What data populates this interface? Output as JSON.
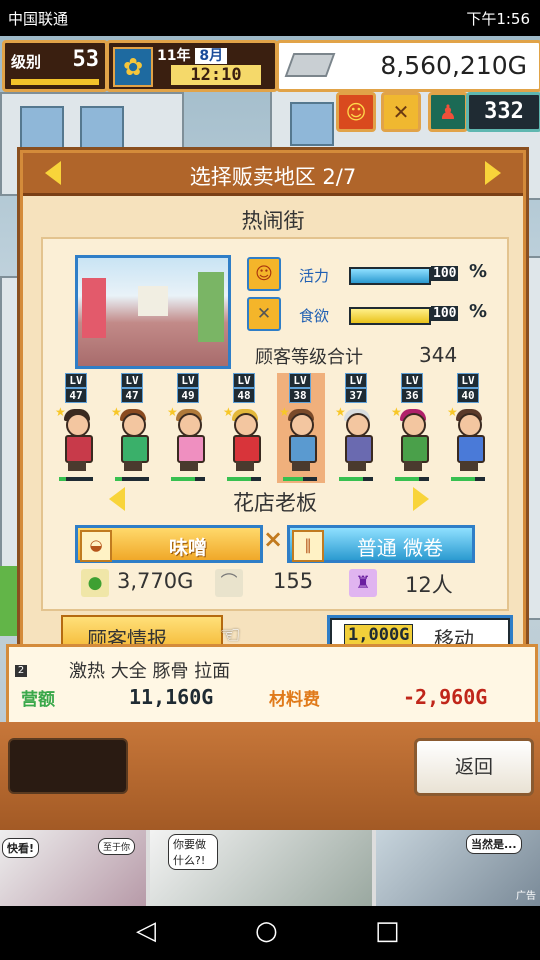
{
  "status_bar": {
    "carrier": "中国联通",
    "time": "下午1:56"
  },
  "hud": {
    "level_label": "级别",
    "level_value": "53",
    "year_text": "11年",
    "month_text": "8月",
    "time": "12:10",
    "money": "8,560,210G",
    "customer_count": "332"
  },
  "panel": {
    "title": "选择贩卖地区 2/7",
    "district": "热闹街",
    "vigor_label": "活力",
    "vigor_value": "100",
    "vigor_percent": 100,
    "appetite_label": "食欲",
    "appetite_value": "100",
    "appetite_percent": 100,
    "percent_sign": "%",
    "total_label": "顾客等级合计",
    "total_value": "344",
    "customers": [
      {
        "lv": "LV",
        "level": "47"
      },
      {
        "lv": "LV",
        "level": "47"
      },
      {
        "lv": "LV",
        "level": "49"
      },
      {
        "lv": "LV",
        "level": "48"
      },
      {
        "lv": "LV",
        "level": "38"
      },
      {
        "lv": "LV",
        "level": "37"
      },
      {
        "lv": "LV",
        "level": "36"
      },
      {
        "lv": "LV",
        "level": "40"
      }
    ],
    "customer_name": "花店老板",
    "soup": "味噌",
    "times": "×",
    "noodle": "普通 微卷",
    "price": "3,770G",
    "spoon_value": "155",
    "people": "12人",
    "info_button": "顾客情报",
    "move_cost": "1,000G",
    "move_label": "移动"
  },
  "shop_row": {
    "rank": "2",
    "name": "激热 大全 豚骨 拉面",
    "revenue_label": "营额",
    "revenue": "11,160G",
    "cost_label": "材料费",
    "cost": "-2,960G"
  },
  "bottom": {
    "back": "返回"
  },
  "ad": {
    "bubble1": "快看!",
    "bubble1b": "至于你",
    "bubble2": "你要做什么?!",
    "bubble3": "当然是...",
    "tag": "广告"
  },
  "colors": {
    "panel_header": "#b0652a",
    "panel_bg": "#f6e2bd",
    "accent_blue": "#2f7ec7",
    "accent_gold": "#f8d43a"
  }
}
